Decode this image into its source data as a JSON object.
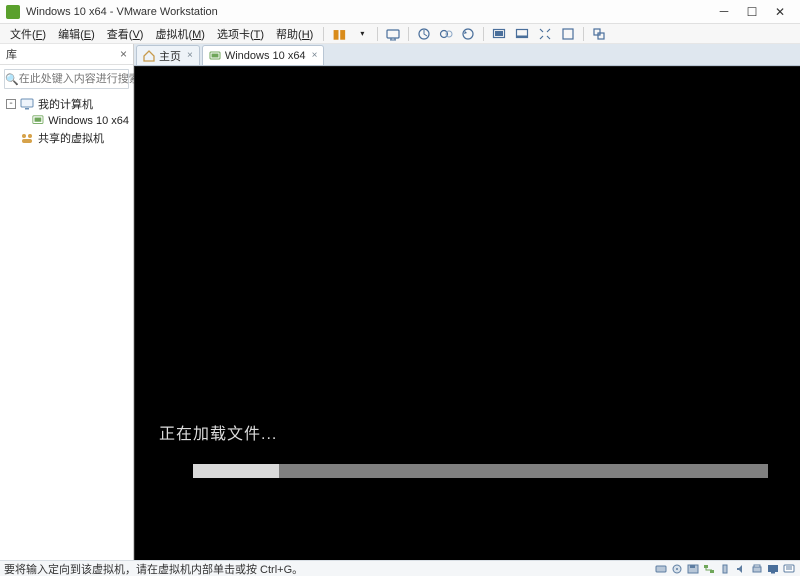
{
  "window": {
    "title": "Windows 10 x64 - VMware Workstation"
  },
  "menu": {
    "file": {
      "label": "文件",
      "accel": "F"
    },
    "edit": {
      "label": "编辑",
      "accel": "E"
    },
    "view": {
      "label": "查看",
      "accel": "V"
    },
    "vm": {
      "label": "虚拟机",
      "accel": "M"
    },
    "tabs": {
      "label": "选项卡",
      "accel": "T"
    },
    "help": {
      "label": "帮助",
      "accel": "H"
    }
  },
  "sidebar": {
    "title": "库",
    "search_placeholder": "在此处键入内容进行搜索",
    "items": [
      {
        "label": "我的计算机",
        "icon": "computer"
      },
      {
        "label": "Windows 10 x64",
        "icon": "vm"
      },
      {
        "label": "共享的虚拟机",
        "icon": "shared"
      }
    ]
  },
  "tabs": {
    "home": {
      "label": "主页"
    },
    "vm": {
      "label": "Windows 10 x64"
    }
  },
  "vm_screen": {
    "loading_text": "正在加载文件...",
    "progress_percent": 15
  },
  "statusbar": {
    "message": "要将输入定向到该虚拟机，请在虚拟机内部单击或按 Ctrl+G。"
  }
}
